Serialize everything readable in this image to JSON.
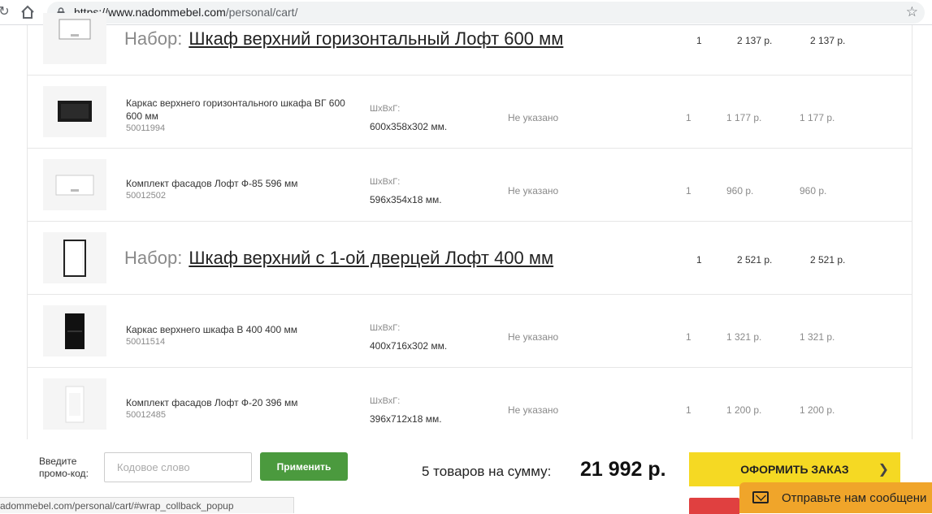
{
  "browser": {
    "url_host": "https://www.nadommebel.com",
    "url_path": "/personal/cart/"
  },
  "cart": {
    "rows": [
      {
        "kind": "set",
        "prefix": "Набор:",
        "title": "Шкаф верхний горизонтальный Лофт 600 мм",
        "qty": "1",
        "price": "2 137 р.",
        "sum": "2 137 р."
      },
      {
        "kind": "item",
        "name": "Каркас верхнего горизонтального шкафа ВГ 600 600 мм",
        "code": "50011994",
        "dim_label": "ШхВхГ:",
        "dim_value": "600x358x302 мм.",
        "note": "Не указано",
        "qty": "1",
        "price": "1 177 р.",
        "sum": "1 177 р."
      },
      {
        "kind": "item",
        "name": "Комплект фасадов Лофт Ф-85 596 мм",
        "code": "50012502",
        "dim_label": "ШхВхГ:",
        "dim_value": "596x354x18 мм.",
        "note": "Не указано",
        "qty": "1",
        "price": "960 р.",
        "sum": "960 р."
      },
      {
        "kind": "set",
        "prefix": "Набор:",
        "title": "Шкаф верхний с 1-ой дверцей Лофт 400 мм",
        "qty": "1",
        "price": "2 521 р.",
        "sum": "2 521 р."
      },
      {
        "kind": "item",
        "name": "Каркас верхнего шкафа В 400 400 мм",
        "code": "50011514",
        "dim_label": "ШхВхГ:",
        "dim_value": "400x716x302 мм.",
        "note": "Не указано",
        "qty": "1",
        "price": "1 321 р.",
        "sum": "1 321 р."
      },
      {
        "kind": "item",
        "name": "Комплект фасадов Лофт Ф-20 396 мм",
        "code": "50012485",
        "dim_label": "ШхВхГ:",
        "dim_value": "396x712x18 мм.",
        "note": "Не указано",
        "qty": "1",
        "price": "1 200 р.",
        "sum": "1 200 р."
      }
    ]
  },
  "footer": {
    "promo_label_line1": "Введите",
    "promo_label_line2": "промо-код:",
    "promo_placeholder": "Кодовое слово",
    "apply_label": "Применить",
    "total_label": "5 товаров на сумму:",
    "total_sum": "21 992 р.",
    "order_label": "ОФОРМИТЬ ЗАКАЗ"
  },
  "status_bar": "adommebel.com/personal/cart/#wrap_collback_popup",
  "chat": {
    "text": "Отправьте нам сообщени"
  },
  "colors": {
    "apply": "#4b9a3e",
    "order": "#f5d923",
    "chat": "#f0a52a"
  }
}
